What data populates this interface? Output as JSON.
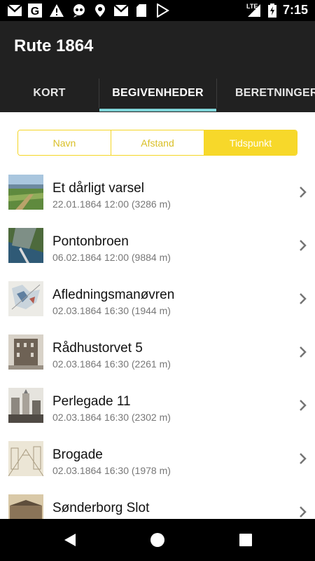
{
  "status_bar": {
    "time": "7:15",
    "network_label": "LTE",
    "left_icons": [
      "gmail-icon",
      "google-icon",
      "warning-icon",
      "voicemail-icon",
      "location-icon",
      "gmail-icon",
      "sd-card-icon",
      "play-store-icon"
    ],
    "right_icons": [
      "signal-icon",
      "battery-charging-icon"
    ]
  },
  "app_bar": {
    "title": "Rute 1864"
  },
  "tabs": [
    {
      "label": "KORT",
      "selected": false
    },
    {
      "label": "BEGIVENHEDER",
      "selected": true
    },
    {
      "label": "BERETNINGER",
      "selected": false
    }
  ],
  "sort": {
    "options": [
      {
        "label": "Navn",
        "selected": false
      },
      {
        "label": "Afstand",
        "selected": false
      },
      {
        "label": "Tidspunkt",
        "selected": true
      }
    ]
  },
  "events": [
    {
      "title": "Et dårligt varsel",
      "subtitle": "22.01.1864 12:00 (3286 m)",
      "thumb": "aerial-landscape"
    },
    {
      "title": "Pontonbroen",
      "subtitle": "06.02.1864 12:00 (9884 m)",
      "thumb": "aerial-town-bridge"
    },
    {
      "title": "Afledningsmanøvren",
      "subtitle": "02.03.1864 16:30 (1944 m)",
      "thumb": "map"
    },
    {
      "title": "Rådhustorvet 5",
      "subtitle": "02.03.1864 16:30 (2261 m)",
      "thumb": "old-building-photo"
    },
    {
      "title": "Perlegade 11",
      "subtitle": "02.03.1864 16:30 (2302 m)",
      "thumb": "old-street-photo"
    },
    {
      "title": "Brogade",
      "subtitle": "02.03.1864 16:30 (1978 m)",
      "thumb": "street-sketch"
    },
    {
      "title": "Sønderborg Slot",
      "subtitle": "",
      "thumb": "castle-photo"
    }
  ],
  "colors": {
    "app_bar": "#212121",
    "status_bar": "#000000",
    "tab_indicator": "#7fd4d8",
    "accent_yellow": "#f7d82a"
  }
}
